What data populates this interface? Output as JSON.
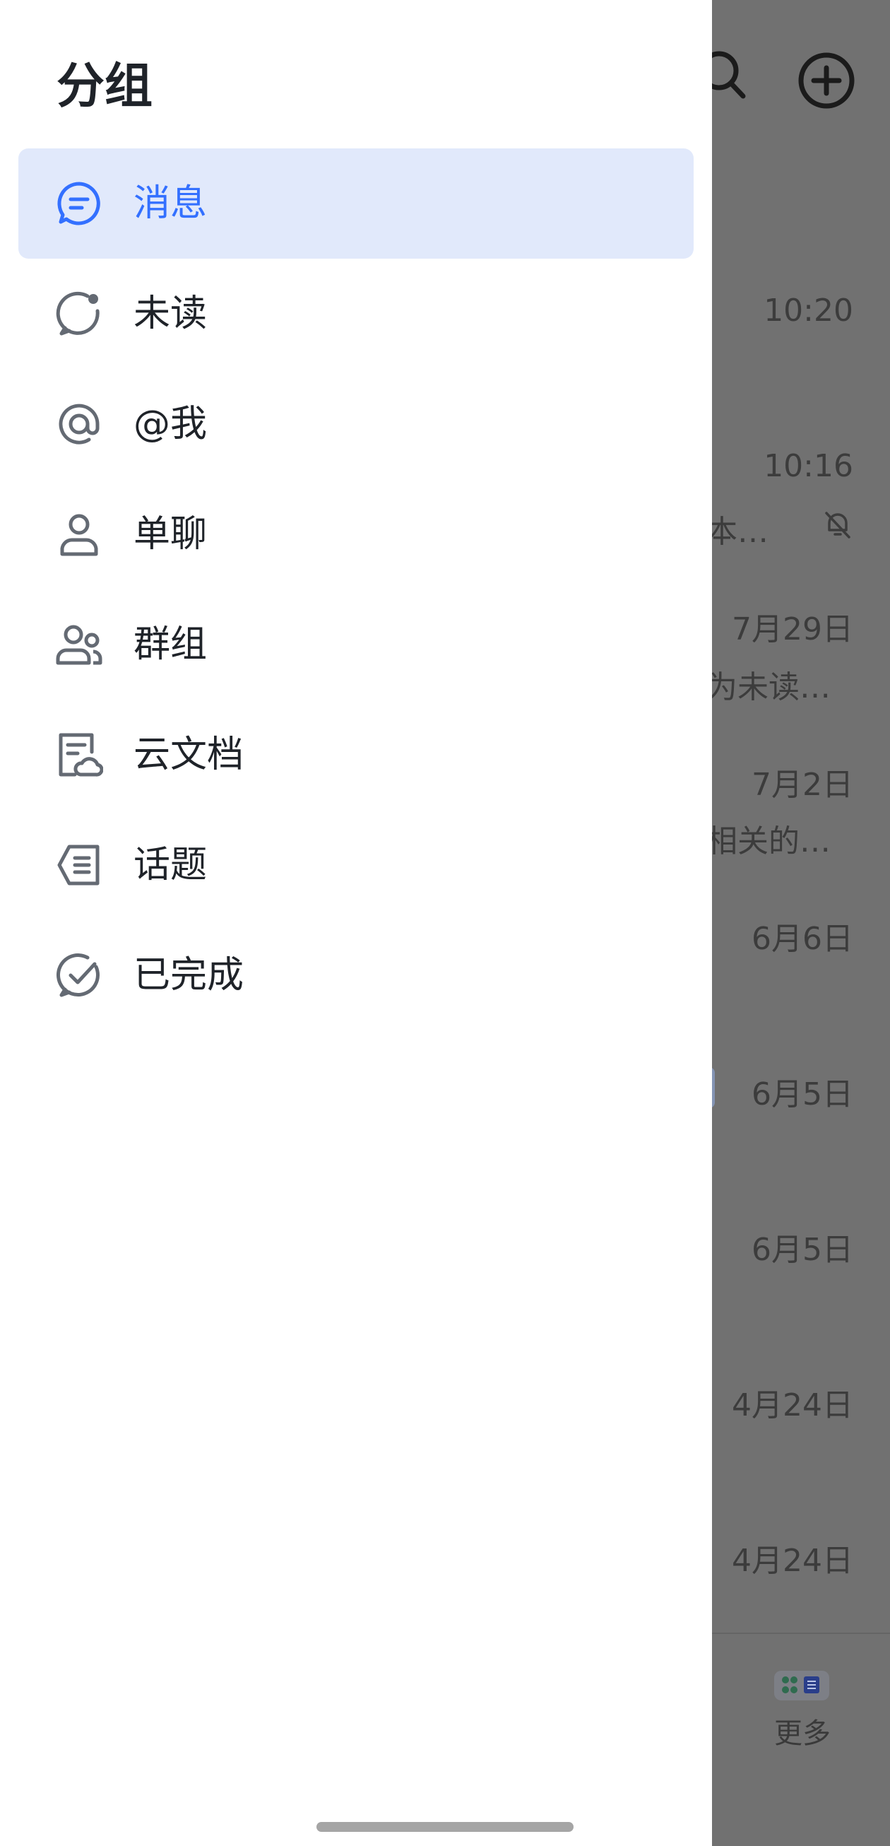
{
  "drawer": {
    "title": "分组",
    "items": [
      {
        "label": "消息",
        "icon": "chat-bubble-icon",
        "active": true
      },
      {
        "label": "未读",
        "icon": "unread-bubble-icon",
        "active": false
      },
      {
        "label": "@我",
        "icon": "at-sign-icon",
        "active": false
      },
      {
        "label": "单聊",
        "icon": "person-icon",
        "active": false
      },
      {
        "label": "群组",
        "icon": "group-icon",
        "active": false
      },
      {
        "label": "云文档",
        "icon": "cloud-doc-icon",
        "active": false
      },
      {
        "label": "话题",
        "icon": "topic-icon",
        "active": false
      },
      {
        "label": "已完成",
        "icon": "check-circle-icon",
        "active": false
      }
    ]
  },
  "background": {
    "times": [
      "10:20",
      "10:16",
      "7月29日",
      "7月2日",
      "6月6日",
      "6月5日",
      "6月5日",
      "4月24日",
      "4月24日"
    ],
    "previews": [
      "本…",
      "为未读…",
      "相关的…"
    ],
    "more_label": "更多"
  },
  "colors": {
    "accent": "#3370ff",
    "active_bg": "#e1e9fb",
    "text": "#1f2329",
    "icon": "#646a73",
    "overlay": "#717171"
  }
}
